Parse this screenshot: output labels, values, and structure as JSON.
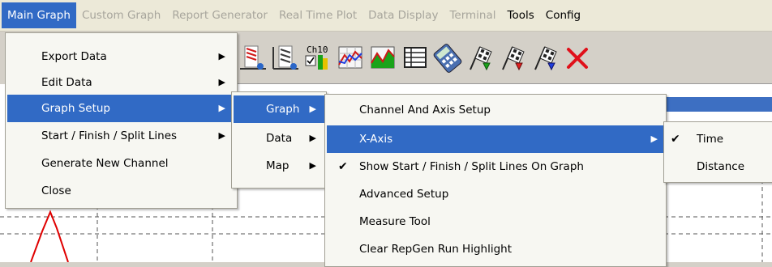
{
  "menubar": {
    "items": [
      {
        "label": "Main Graph",
        "state": "active"
      },
      {
        "label": "Custom Graph",
        "state": "disabled"
      },
      {
        "label": "Report Generator",
        "state": "disabled"
      },
      {
        "label": "Real Time Plot",
        "state": "disabled"
      },
      {
        "label": "Data Display",
        "state": "disabled"
      },
      {
        "label": "Terminal",
        "state": "disabled"
      },
      {
        "label": "Tools",
        "state": "enabled"
      },
      {
        "label": "Config",
        "state": "enabled"
      }
    ]
  },
  "toolbar": {
    "icon_names": [
      "export-graph-icon",
      "export-bars-icon",
      "channel-icon",
      "graph-overlay-icon",
      "graph-fill-icon",
      "table-grid-icon",
      "calculator-icon",
      "flag-green-icon",
      "flag-red-icon",
      "flag-blue-icon",
      "delete-x-icon"
    ],
    "channel_icon_text": "Ch10",
    "colors": {
      "flag_green": "#1aa31a",
      "flag_red": "#e01e1e",
      "flag_blue": "#1e3ee0",
      "delete_red": "#e0101a"
    }
  },
  "main_menu": {
    "items": [
      {
        "label": "Export Data",
        "submenu": true,
        "highlighted": false
      },
      {
        "label": "Edit Data",
        "submenu": true,
        "highlighted": false
      },
      {
        "label": "Graph Setup",
        "submenu": true,
        "highlighted": true
      },
      {
        "label": "Start / Finish / Split Lines",
        "submenu": true,
        "highlighted": false
      },
      {
        "label": "Generate New Channel",
        "submenu": false,
        "highlighted": false
      },
      {
        "label": "Close",
        "submenu": false,
        "highlighted": false
      }
    ]
  },
  "graph_setup_menu": {
    "items": [
      {
        "label": "Graph",
        "submenu": true,
        "highlighted": true
      },
      {
        "label": "Data",
        "submenu": true,
        "highlighted": false
      },
      {
        "label": "Map",
        "submenu": true,
        "highlighted": false
      }
    ]
  },
  "graph_menu": {
    "items": [
      {
        "label": "Channel And Axis Setup",
        "submenu": false,
        "checked": false,
        "highlighted": false
      },
      {
        "label": "X-Axis",
        "submenu": true,
        "checked": false,
        "highlighted": true
      },
      {
        "label": "Show Start / Finish / Split Lines On Graph",
        "submenu": false,
        "checked": true,
        "highlighted": false
      },
      {
        "label": "Advanced Setup",
        "submenu": false,
        "checked": false,
        "highlighted": false
      },
      {
        "label": "Measure Tool",
        "submenu": false,
        "checked": false,
        "highlighted": false
      },
      {
        "label": "Clear RepGen Run Highlight",
        "submenu": false,
        "checked": false,
        "highlighted": false
      }
    ]
  },
  "xaxis_menu": {
    "items": [
      {
        "label": "Time",
        "checked": true
      },
      {
        "label": "Distance",
        "checked": false
      }
    ]
  },
  "glyphs": {
    "arrow": "▶",
    "check": "✔"
  },
  "colors": {
    "highlight": "#316ac5",
    "menu_bg": "#f7f7f2",
    "trace": "#e00000"
  }
}
